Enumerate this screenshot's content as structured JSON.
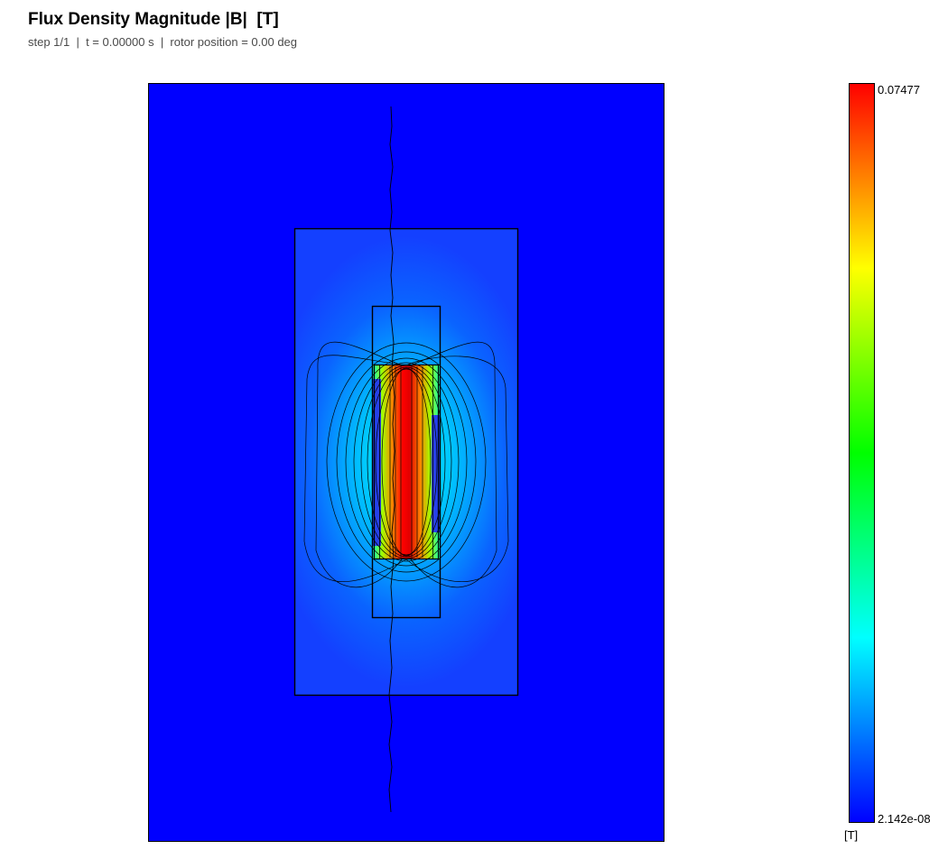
{
  "header": {
    "title": "Flux Density Magnitude |B|  [T]",
    "subtitle": "step 1/1  |  t = 0.00000 s  |  rotor position = 0.00 deg"
  },
  "colorbar": {
    "max_label": "0.07477",
    "min_label": "2.142e-08",
    "unit_label": "[T]",
    "max_value": 0.07477,
    "min_value": 2.142e-08,
    "colors": [
      "#0000ff",
      "#00ffff",
      "#00ff00",
      "#ffff00",
      "#ff0000"
    ]
  },
  "field": {
    "outer_color": "#0000ff",
    "outline_color": "#000000"
  }
}
